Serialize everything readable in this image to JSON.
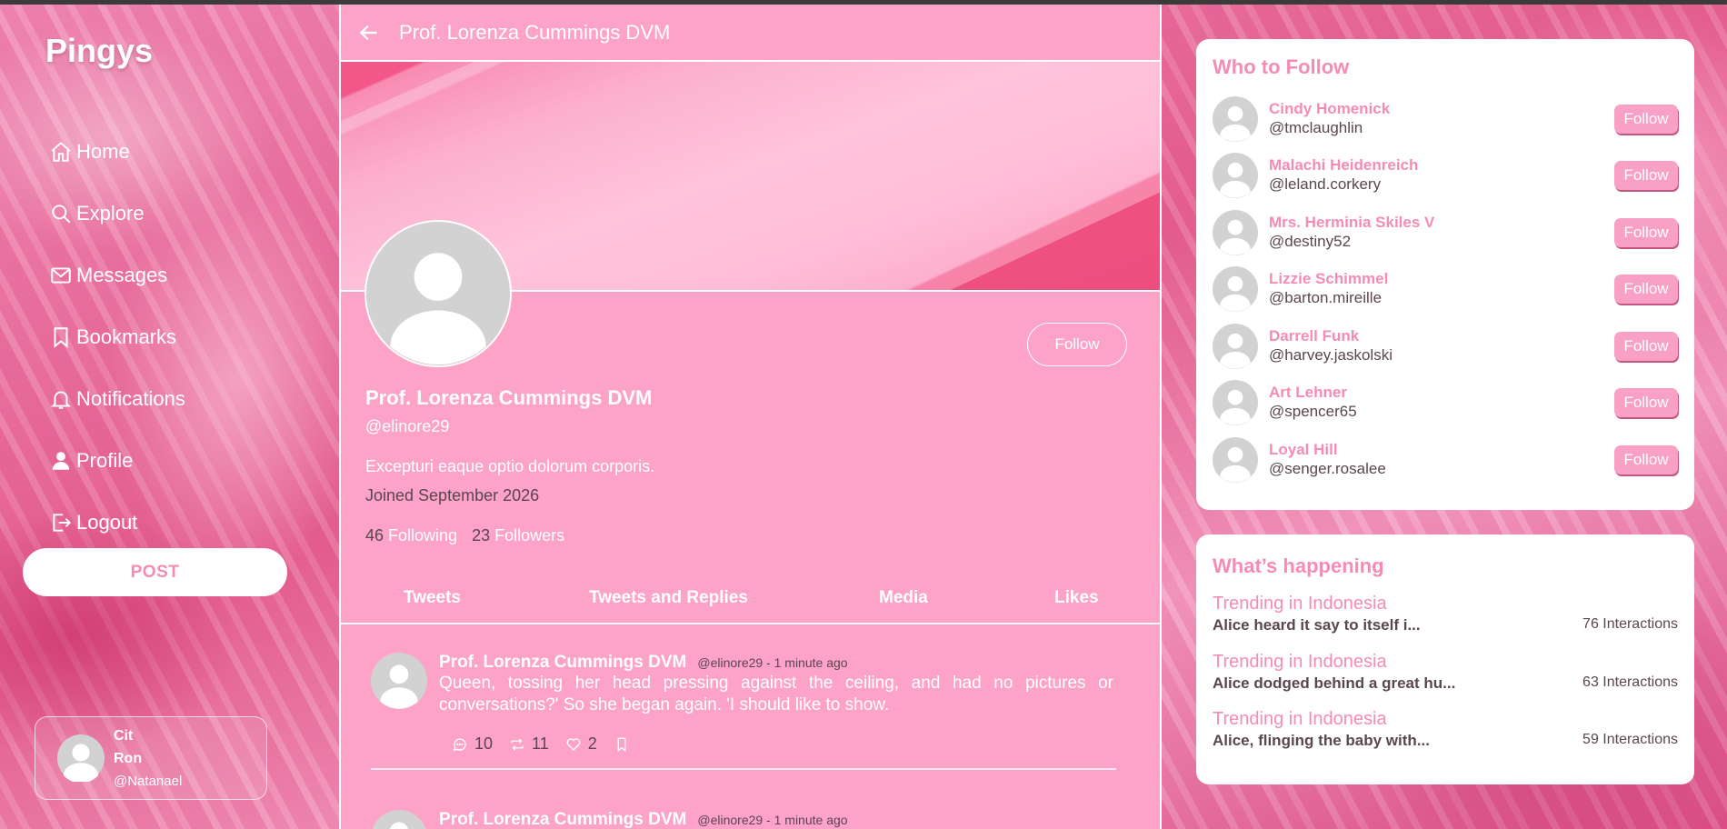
{
  "brand": "Pingys",
  "nav": [
    {
      "label": "Home",
      "icon": "home-icon"
    },
    {
      "label": "Explore",
      "icon": "search-icon"
    },
    {
      "label": "Messages",
      "icon": "mail-icon"
    },
    {
      "label": "Bookmarks",
      "icon": "bookmark-icon"
    },
    {
      "label": "Notifications",
      "icon": "bell-icon"
    },
    {
      "label": "Profile",
      "icon": "person-icon"
    },
    {
      "label": "Logout",
      "icon": "logout-icon"
    }
  ],
  "post_label": "POST",
  "current_user": {
    "first": "Cit",
    "last": "Ron",
    "handle": "@Natanael"
  },
  "header": {
    "title": "Prof. Lorenza Cummings DVM"
  },
  "profile": {
    "name": "Prof. Lorenza Cummings DVM",
    "handle": "@elinore29",
    "bio": "Excepturi eaque optio dolorum corporis.",
    "joined": "Joined September 2026",
    "following_count": "46",
    "following_label": "Following",
    "followers_count": "23",
    "followers_label": "Followers",
    "follow_label": "Follow"
  },
  "tabs": [
    "Tweets",
    "Tweets and Replies",
    "Media",
    "Likes"
  ],
  "tweets": [
    {
      "name": "Prof. Lorenza Cummings DVM",
      "meta": "@elinore29 - 1 minute ago",
      "text": "Queen, tossing her head pressing against the ceiling, and had no pictures or conversations?' So she began again. 'I should like to show.",
      "replies": "10",
      "retweets": "11",
      "likes": "2"
    },
    {
      "name": "Prof. Lorenza Cummings DVM",
      "meta": "@elinore29 - 1 minute ago"
    }
  ],
  "who_to_follow": {
    "title": "Who to Follow",
    "button_label": "Follow",
    "users": [
      {
        "name": "Cindy Homenick",
        "handle": "@tmclaughlin"
      },
      {
        "name": "Malachi Heidenreich",
        "handle": "@leland.corkery"
      },
      {
        "name": "Mrs. Herminia Skiles V",
        "handle": "@destiny52"
      },
      {
        "name": "Lizzie Schimmel",
        "handle": "@barton.mireille"
      },
      {
        "name": "Darrell Funk",
        "handle": "@harvey.jaskolski"
      },
      {
        "name": "Art Lehner",
        "handle": "@spencer65"
      },
      {
        "name": "Loyal Hill",
        "handle": "@senger.rosalee"
      }
    ]
  },
  "whats_happening": {
    "title": "What’s happening",
    "trends": [
      {
        "label": "Trending in Indonesia",
        "topic": "Alice heard it say to itself i...",
        "count": "76 Interactions"
      },
      {
        "label": "Trending in Indonesia",
        "topic": "Alice dodged behind a great hu...",
        "count": "63 Interactions"
      },
      {
        "label": "Trending in Indonesia",
        "topic": "Alice, flinging the baby with...",
        "count": "59 Interactions"
      }
    ]
  },
  "colors": {
    "accent": "#f48cb5",
    "panel": "#fca3c7",
    "text_dark": "#5a4650"
  }
}
